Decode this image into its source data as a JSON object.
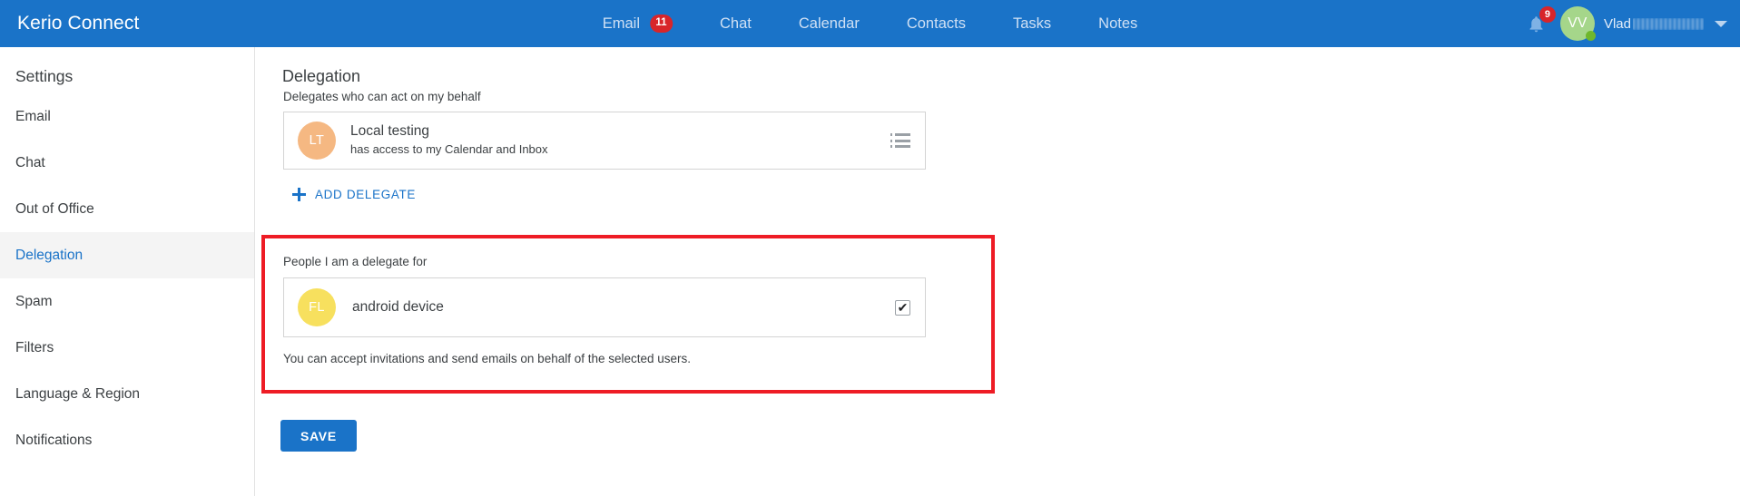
{
  "app": {
    "brand": "Kerio Connect",
    "accent_color": "#1a73c8",
    "badge_color": "#d8252a",
    "highlight_border_color": "#ee1c25"
  },
  "topnav": {
    "items": [
      {
        "label": "Email",
        "badge": "11"
      },
      {
        "label": "Chat",
        "badge": ""
      },
      {
        "label": "Calendar",
        "badge": ""
      },
      {
        "label": "Contacts",
        "badge": ""
      },
      {
        "label": "Tasks",
        "badge": ""
      },
      {
        "label": "Notes",
        "badge": ""
      }
    ]
  },
  "topbar_right": {
    "bell_icon": "bell-icon",
    "notification_count": "9",
    "avatar_initials": "VV",
    "avatar_color": "#a5d68a",
    "status_color": "#6fb72c",
    "user_first_name": "Vlad",
    "caret_icon": "chevron-down-icon"
  },
  "sidebar": {
    "title": "Settings",
    "items": [
      {
        "label": "Email",
        "active": false
      },
      {
        "label": "Chat",
        "active": false
      },
      {
        "label": "Out of Office",
        "active": false
      },
      {
        "label": "Delegation",
        "active": true
      },
      {
        "label": "Spam",
        "active": false
      },
      {
        "label": "Filters",
        "active": false
      },
      {
        "label": "Language & Region",
        "active": false
      },
      {
        "label": "Notifications",
        "active": false
      }
    ]
  },
  "main": {
    "page_title": "Delegation",
    "delegates_section": {
      "label": "Delegates who can act on my behalf",
      "delegate": {
        "avatar_initials": "LT",
        "avatar_color": "#f5b882",
        "name": "Local testing",
        "description": "has access to my Calendar and Inbox",
        "menu_icon": "list-menu-icon"
      },
      "add_delegate_label": "ADD DELEGATE",
      "add_icon": "plus-icon"
    },
    "delegate_for_section": {
      "label": "People I am a delegate for",
      "person": {
        "avatar_initials": "FL",
        "avatar_color": "#f7e05e",
        "name": "android device",
        "checked": true,
        "check_glyph": "✔"
      },
      "helper_text": "You can accept invitations and send emails on behalf of the selected users."
    },
    "save_label": "SAVE"
  }
}
